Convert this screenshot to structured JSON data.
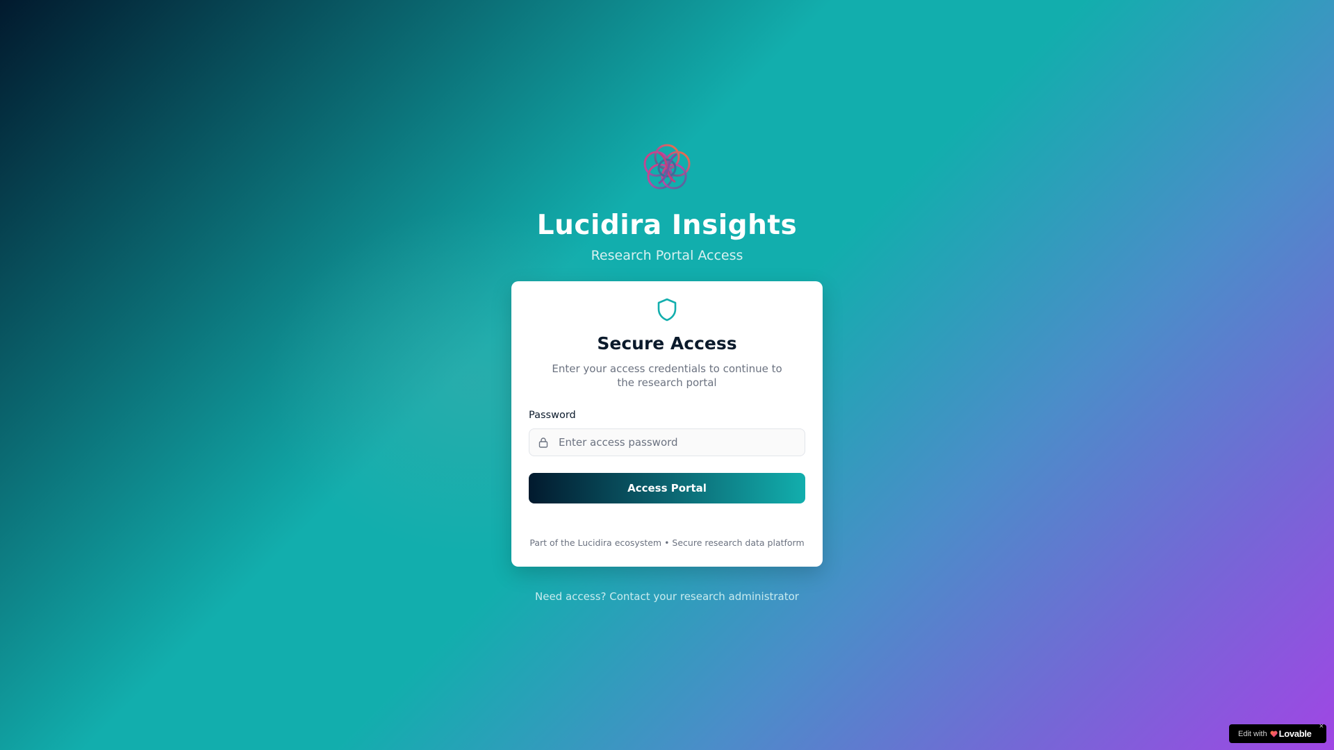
{
  "brand": {
    "title": "Lucidira Insights",
    "subtitle": "Research Portal Access",
    "logo_icon": "knot-flower-logo"
  },
  "login_card": {
    "icon": "shield-icon",
    "title": "Secure Access",
    "description": "Enter your access credentials to continue to the research portal",
    "password_label": "Password",
    "password_placeholder": "Enter access password",
    "password_value": "",
    "submit_label": "Access Portal",
    "footer": "Part of the Lucidira ecosystem • Secure research data platform"
  },
  "help_text": "Need access? Contact your research administrator",
  "badge": {
    "prefix": "Edit with",
    "brand": "Lovable",
    "close": "×"
  },
  "colors": {
    "accent": "#12aead",
    "dark": "#021a2e",
    "purple": "#a046e4"
  }
}
